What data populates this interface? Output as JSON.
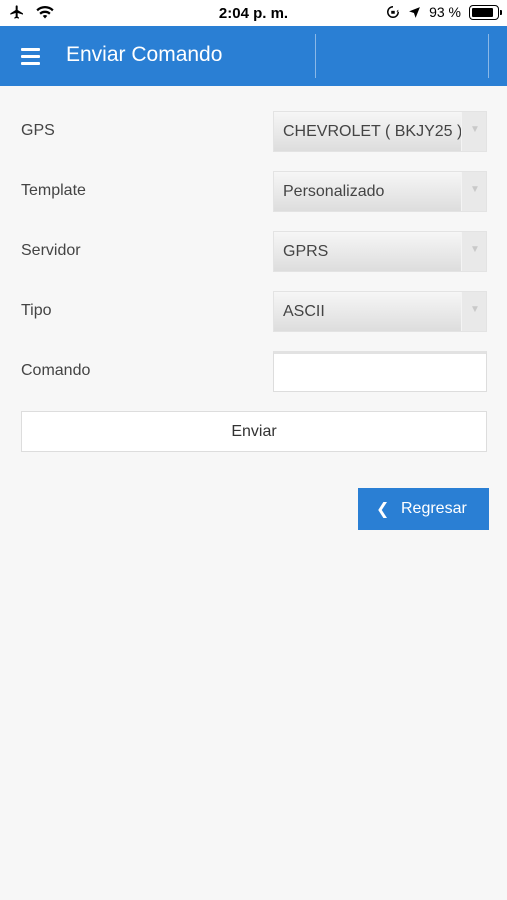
{
  "status_bar": {
    "time": "2:04 p. m.",
    "battery_percent": "93 %",
    "battery_level": 0.93,
    "left_icons": [
      "airplane-icon",
      "wifi-icon"
    ],
    "right_icons": [
      "orientation-lock-icon",
      "location-arrow-icon"
    ]
  },
  "app_bar": {
    "title": "Enviar Comando",
    "menu_icon": "hamburger-menu-icon",
    "color": "#2a7fd4"
  },
  "form": {
    "gps": {
      "label": "GPS",
      "value": "CHEVROLET ( BKJY25 )"
    },
    "template": {
      "label": "Template",
      "value": "Personalizado"
    },
    "servidor": {
      "label": "Servidor",
      "value": "GPRS"
    },
    "tipo": {
      "label": "Tipo",
      "value": "ASCII"
    },
    "comando": {
      "label": "Comando",
      "value": ""
    }
  },
  "actions": {
    "send_label": "Enviar",
    "back_label": "Regresar",
    "back_icon": "chevron-left-icon"
  }
}
